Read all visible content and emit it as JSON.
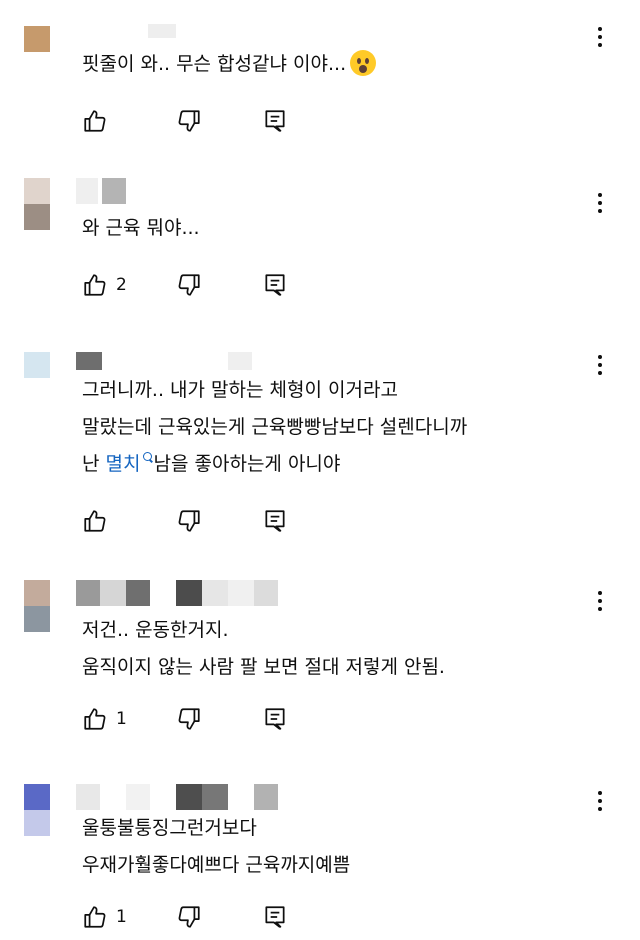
{
  "comments": [
    {
      "avatar_colors": [
        "#c69a6c",
        "#ffffff"
      ],
      "lines": [
        "핏줄이 와.. 무슨 합성같냐 이야..."
      ],
      "emoji": "astonished-face",
      "likes": "",
      "mention": null
    },
    {
      "avatar_colors": [
        "#e0d4cc",
        "#9c8e84"
      ],
      "lines": [
        "와 근육 뭐야..."
      ],
      "likes": "2",
      "mention": null
    },
    {
      "avatar_colors": [
        "#d5e6f0",
        "#ffffff"
      ],
      "lines": [
        "그러니까.. 내가 말하는 체형이 이거라고",
        "말랐는데 근육있는게 근육빵빵남보다 설렌다니까"
      ],
      "line3_prefix": "난 ",
      "mention": "멸치",
      "line3_suffix": "남을 좋아하는게 아니야",
      "likes": ""
    },
    {
      "avatar_colors": [
        "#c3ab9c",
        "#8c96a0"
      ],
      "lines": [
        "저건.. 운동한거지.",
        "움직이지 않는 사람 팔 보면 절대 저렇게 안됨."
      ],
      "likes": "1",
      "mention": null
    },
    {
      "avatar_colors": [
        "#5a69c6",
        "#c4c9ea"
      ],
      "lines": [
        "울퉁불퉁징그런거보다",
        "우재가훨좋다예쁘다 근육까지예쁨"
      ],
      "likes": "1",
      "mention": null
    }
  ],
  "icons": {
    "like": "thumbs-up-icon",
    "dislike": "thumbs-down-icon",
    "reply": "reply-comment-icon",
    "more": "more-vertical-icon"
  }
}
